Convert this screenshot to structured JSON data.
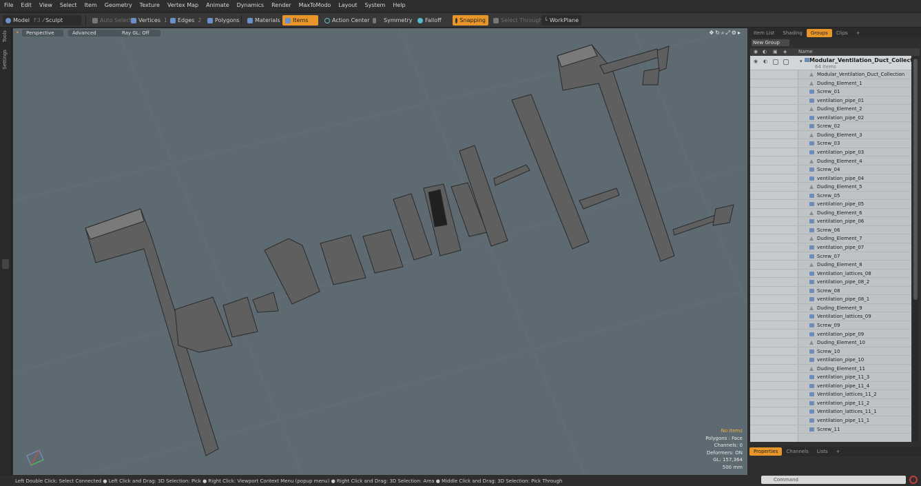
{
  "menu": [
    "File",
    "Edit",
    "View",
    "Select",
    "Item",
    "Geometry",
    "Texture",
    "Vertex Map",
    "Animate",
    "Dynamics",
    "Render",
    "MaxToModo",
    "Layout",
    "System",
    "Help"
  ],
  "toolbar": {
    "model": "Model",
    "model_key": "F3",
    "sculpt": "Sculpt",
    "auto_select": "Auto Select",
    "vertices": "Vertices",
    "vertices_key": "1",
    "edges": "Edges",
    "edges_key": "2",
    "polygons": "Polygons",
    "materials": "Materials",
    "items": "Items",
    "action_center": "Action Center",
    "symmetry": "Symmetry",
    "falloff": "Falloff",
    "snapping": "Snapping",
    "select_through": "Select Through",
    "workplane": "WorkPlane"
  },
  "left_tabs": [
    "Tools",
    "Settings"
  ],
  "viewport": {
    "view": "Perspective",
    "shading": "Advanced",
    "raygl": "Ray GL: Off",
    "stats": {
      "no_items": "No Items",
      "polygons": "Polygons : Face",
      "channels": "Channels: 0",
      "deformers": "Deformers: ON",
      "gl": "GL: 157,364",
      "size": "500 mm"
    },
    "accent": "#e8962a"
  },
  "status": "Left Double Click: Select Connected ● Left Click and Drag: 3D Selection: Pick ● Right Click: Viewport Context Menu (popup menu) ● Right Click and Drag: 3D Selection: Area ● Middle Click and Drag: 3D Selection: Pick Through",
  "right_panel": {
    "tabs": [
      "Item List",
      "Shading",
      "Groups",
      "Clips",
      "+"
    ],
    "new_group": "New Group",
    "column_name": "Name",
    "group_name": "Modular_Ventilation_Duct_Collecti...",
    "group_count": "64 Items",
    "items": [
      {
        "n": "Modular_Ventilation_Duct_Collection",
        "t": "loc"
      },
      {
        "n": "Duding_Element_1",
        "t": "loc"
      },
      {
        "n": "Screw_01",
        "t": "mesh"
      },
      {
        "n": "ventilation_pipe_01",
        "t": "mesh"
      },
      {
        "n": "Duding_Element_2",
        "t": "loc"
      },
      {
        "n": "ventilation_pipe_02",
        "t": "mesh"
      },
      {
        "n": "Screw_02",
        "t": "mesh"
      },
      {
        "n": "Duding_Element_3",
        "t": "loc"
      },
      {
        "n": "Screw_03",
        "t": "mesh"
      },
      {
        "n": "ventilation_pipe_03",
        "t": "mesh"
      },
      {
        "n": "Duding_Element_4",
        "t": "loc"
      },
      {
        "n": "Screw_04",
        "t": "mesh"
      },
      {
        "n": "ventilation_pipe_04",
        "t": "mesh"
      },
      {
        "n": "Duding_Element_5",
        "t": "loc"
      },
      {
        "n": "Screw_05",
        "t": "mesh"
      },
      {
        "n": "ventilation_pipe_05",
        "t": "mesh"
      },
      {
        "n": "Duding_Element_6",
        "t": "loc"
      },
      {
        "n": "ventilation_pipe_06",
        "t": "mesh"
      },
      {
        "n": "Screw_06",
        "t": "mesh"
      },
      {
        "n": "Duding_Element_7",
        "t": "loc"
      },
      {
        "n": "ventilation_pipe_07",
        "t": "mesh"
      },
      {
        "n": "Screw_07",
        "t": "mesh"
      },
      {
        "n": "Duding_Element_8",
        "t": "loc"
      },
      {
        "n": "Ventilation_lattices_08",
        "t": "mesh"
      },
      {
        "n": "ventilation_pipe_08_2",
        "t": "mesh"
      },
      {
        "n": "Screw_08",
        "t": "mesh"
      },
      {
        "n": "ventilation_pipe_08_1",
        "t": "mesh"
      },
      {
        "n": "Duding_Element_9",
        "t": "loc"
      },
      {
        "n": "Ventilation_lattices_09",
        "t": "mesh"
      },
      {
        "n": "Screw_09",
        "t": "mesh"
      },
      {
        "n": "ventilation_pipe_09",
        "t": "mesh"
      },
      {
        "n": "Duding_Element_10",
        "t": "loc"
      },
      {
        "n": "Screw_10",
        "t": "mesh"
      },
      {
        "n": "ventilation_pipe_10",
        "t": "mesh"
      },
      {
        "n": "Duding_Element_11",
        "t": "loc"
      },
      {
        "n": "ventilation_pipe_11_3",
        "t": "mesh"
      },
      {
        "n": "ventilation_pipe_11_4",
        "t": "mesh"
      },
      {
        "n": "Ventilation_lattices_11_2",
        "t": "mesh"
      },
      {
        "n": "ventilation_pipe_11_2",
        "t": "mesh"
      },
      {
        "n": "Ventilation_lattices_11_1",
        "t": "mesh"
      },
      {
        "n": "ventilation_pipe_11_1",
        "t": "mesh"
      },
      {
        "n": "Screw_11",
        "t": "mesh"
      }
    ],
    "bottom_tabs": [
      "Properties",
      "Channels",
      "Lists",
      "+"
    ],
    "command_placeholder": "Command"
  }
}
